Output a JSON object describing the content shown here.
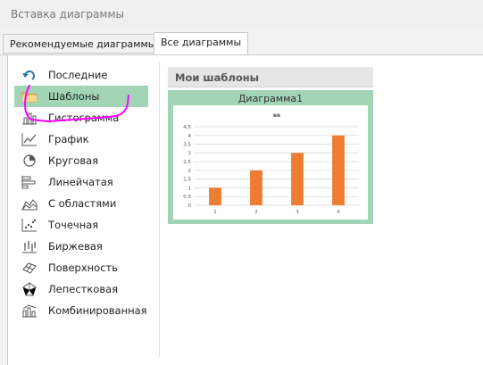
{
  "dialog": {
    "title": "Вставка диаграммы"
  },
  "tabs": [
    {
      "label": "Рекомендуемые диаграммы",
      "active": false
    },
    {
      "label": "Все диаграммы",
      "active": true
    }
  ],
  "sidebar": {
    "selected": "Шаблоны",
    "items": [
      {
        "label": "Последние",
        "icon": "undo-arrow-icon"
      },
      {
        "label": "Шаблоны",
        "icon": "folder-icon"
      },
      {
        "label": "Гистограмма",
        "icon": "column-chart-icon"
      },
      {
        "label": "График",
        "icon": "line-chart-icon"
      },
      {
        "label": "Круговая",
        "icon": "pie-chart-icon"
      },
      {
        "label": "Линейчатая",
        "icon": "bar-chart-icon"
      },
      {
        "label": "С областями",
        "icon": "area-chart-icon"
      },
      {
        "label": "Точечная",
        "icon": "scatter-chart-icon"
      },
      {
        "label": "Биржевая",
        "icon": "stock-chart-icon"
      },
      {
        "label": "Поверхность",
        "icon": "surface-chart-icon"
      },
      {
        "label": "Лепестковая",
        "icon": "radar-chart-icon"
      },
      {
        "label": "Комбинированная",
        "icon": "combo-chart-icon"
      }
    ]
  },
  "main": {
    "section_title": "Мои шаблоны",
    "template_name": "Диаграмма1"
  },
  "colors": {
    "selection": "#a2d5b6",
    "bar": "#ed7d31",
    "annotation": "#ff00ff",
    "icon": "#555555",
    "icon_accent": "#2e75b6"
  },
  "chart_data": {
    "type": "bar",
    "title": "вв",
    "categories": [
      "1",
      "2",
      "3",
      "4"
    ],
    "values": [
      1,
      2,
      3,
      4
    ],
    "ylim": [
      0,
      4.5
    ],
    "yticks": [
      "0",
      "0,5",
      "1",
      "1,5",
      "2",
      "2,5",
      "3",
      "3,5",
      "4",
      "4,5"
    ],
    "grid": true,
    "legend": "none"
  }
}
